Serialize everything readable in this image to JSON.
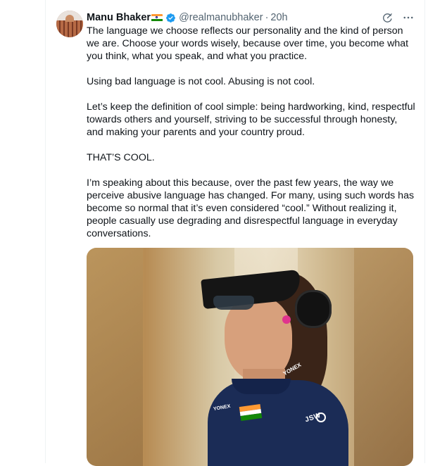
{
  "tweet": {
    "author": {
      "name": "Manu Bhaker",
      "handle": "@realmanubhaker",
      "time": "20h",
      "separator": "·"
    },
    "icons": {
      "flag": "india-flag-icon",
      "verified": "verified-badge-icon",
      "grok": "grok-icon",
      "more": "more-icon"
    },
    "colors": {
      "verified": "#1d9bf0",
      "secondary_text": "#536471",
      "text": "#0f1419"
    },
    "paragraphs": [
      "The language we choose reflects our personality and the kind of person we are. Choose your words wisely, because over time, you become what you think, what you speak, and what you practice.",
      "Using bad language is not cool. Abusing is not cool.",
      "Let’s keep the definition of cool simple: being hardworking, kind, respectful towards others and yourself, striving to be successful through honesty, and making your parents and your country proud.",
      "THAT’S COOL.",
      "I’m speaking about this because, over the past few years, the way we perceive abusive language has changed. For many, using such words has become so normal that it’s even considered “cool.” Without realizing it, people casually use degrading and disrespectful language in everyday conversations."
    ],
    "media": {
      "jersey_text_1": "JSW",
      "jersey_text_2": "YONEX",
      "jersey_text_3": "YONEX"
    }
  }
}
